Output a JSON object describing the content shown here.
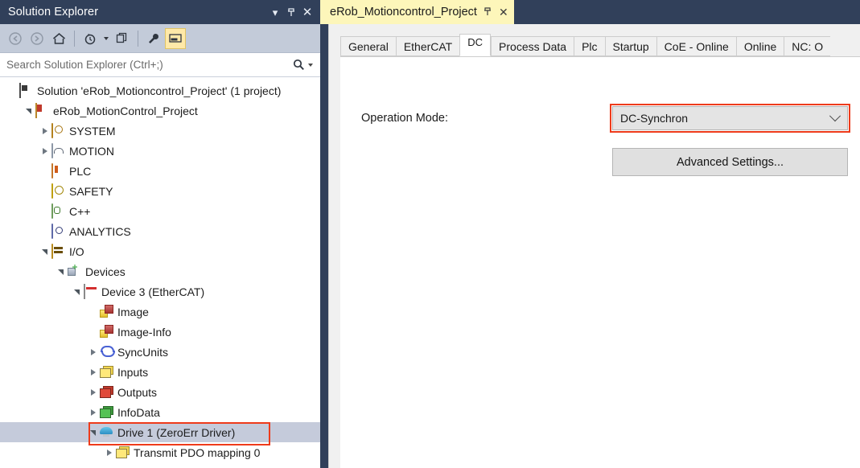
{
  "solution_explorer": {
    "title": "Solution Explorer",
    "titlebar_buttons": [
      {
        "name": "dropdown",
        "glyph": "▾"
      },
      {
        "name": "pin",
        "glyph": "⇥"
      },
      {
        "name": "close",
        "glyph": "✕"
      }
    ],
    "toolbar": {
      "back_label": "◀",
      "forward_label": "▶",
      "home_label": "⌂",
      "pending_changes_label": "◷",
      "sync_label": "❐",
      "properties_label": "🔧",
      "preview_label": "▬"
    },
    "search": {
      "placeholder": "Search Solution Explorer (Ctrl+;)",
      "value": "",
      "icon": "search-icon"
    },
    "tree": [
      {
        "label": "Solution 'eRob_Motioncontrol_Project' (1 project)",
        "indent": 0,
        "arrow": "none",
        "icon": "solution",
        "selected": false,
        "boxed": false
      },
      {
        "label": "eRob_MotionControl_Project",
        "indent": 1,
        "arrow": "expanded",
        "icon": "project",
        "selected": false,
        "boxed": false
      },
      {
        "label": "SYSTEM",
        "indent": 2,
        "arrow": "collapsed",
        "icon": "system",
        "selected": false,
        "boxed": false
      },
      {
        "label": "MOTION",
        "indent": 2,
        "arrow": "collapsed",
        "icon": "motion",
        "selected": false,
        "boxed": false
      },
      {
        "label": "PLC",
        "indent": 2,
        "arrow": "none",
        "icon": "plc",
        "selected": false,
        "boxed": false
      },
      {
        "label": "SAFETY",
        "indent": 2,
        "arrow": "none",
        "icon": "safety",
        "selected": false,
        "boxed": false
      },
      {
        "label": "C++",
        "indent": 2,
        "arrow": "none",
        "icon": "cpp",
        "selected": false,
        "boxed": false
      },
      {
        "label": "ANALYTICS",
        "indent": 2,
        "arrow": "none",
        "icon": "analytics",
        "selected": false,
        "boxed": false
      },
      {
        "label": "I/O",
        "indent": 2,
        "arrow": "expanded",
        "icon": "io",
        "selected": false,
        "boxed": false
      },
      {
        "label": "Devices",
        "indent": 3,
        "arrow": "expanded",
        "icon": "devices",
        "selected": false,
        "boxed": false
      },
      {
        "label": "Device 3 (EtherCAT)",
        "indent": 4,
        "arrow": "expanded",
        "icon": "ethercat",
        "selected": false,
        "boxed": false
      },
      {
        "label": "Image",
        "indent": 5,
        "arrow": "none",
        "icon": "image",
        "selected": false,
        "boxed": false
      },
      {
        "label": "Image-Info",
        "indent": 5,
        "arrow": "none",
        "icon": "image",
        "selected": false,
        "boxed": false
      },
      {
        "label": "SyncUnits",
        "indent": 5,
        "arrow": "collapsed",
        "icon": "syncunits",
        "selected": false,
        "boxed": false
      },
      {
        "label": "Inputs",
        "indent": 5,
        "arrow": "collapsed",
        "icon": "folder-yellow",
        "selected": false,
        "boxed": false
      },
      {
        "label": "Outputs",
        "indent": 5,
        "arrow": "collapsed",
        "icon": "folder-red",
        "selected": false,
        "boxed": false
      },
      {
        "label": "InfoData",
        "indent": 5,
        "arrow": "collapsed",
        "icon": "folder-green",
        "selected": false,
        "boxed": false
      },
      {
        "label": "Drive 1 (ZeroErr Driver)",
        "indent": 5,
        "arrow": "expanded",
        "icon": "drive",
        "selected": true,
        "boxed": true
      },
      {
        "label": "Transmit PDO mapping 0",
        "indent": 6,
        "arrow": "collapsed",
        "icon": "folder-yellow",
        "selected": false,
        "boxed": false
      }
    ]
  },
  "document": {
    "tab": {
      "label": "eRob_Motioncontrol_Project",
      "pin_glyph": "⇥",
      "close_glyph": "✕"
    },
    "property_tabs": [
      {
        "label": "General",
        "active": false
      },
      {
        "label": "EtherCAT",
        "active": false
      },
      {
        "label": "DC",
        "active": true
      },
      {
        "label": "Process Data",
        "active": false
      },
      {
        "label": "Plc",
        "active": false
      },
      {
        "label": "Startup",
        "active": false
      },
      {
        "label": "CoE - Online",
        "active": false
      },
      {
        "label": "Online",
        "active": false
      },
      {
        "label": "NC: O",
        "active": false
      }
    ],
    "dc_panel": {
      "operation_mode_label": "Operation Mode:",
      "operation_mode_value": "DC-Synchron",
      "advanced_settings_label": "Advanced Settings..."
    }
  },
  "colors": {
    "chrome_dark": "#31405a",
    "toolbar": "#c3cbd9",
    "tab_active": "#fdf6ba",
    "selection": "#c5cbdb",
    "highlight_box": "#ee3b1b",
    "toolbar_highlight": "#ffe9a8"
  }
}
